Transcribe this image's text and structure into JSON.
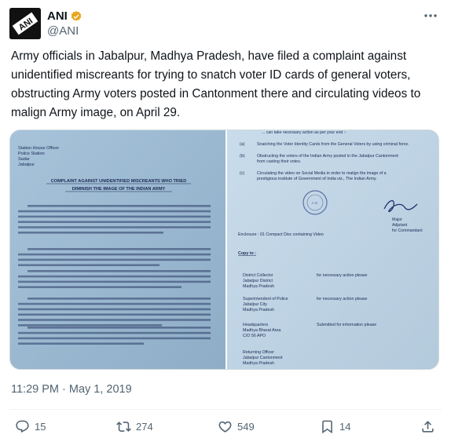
{
  "author": {
    "display_name": "ANI",
    "handle": "@ANI",
    "avatar_text": "ANI"
  },
  "tweet": {
    "text": "Army officials in Jabalpur, Madhya Pradesh, have filed a complaint against unidentified miscreants for trying to snatch voter ID cards of general voters, obstructing Army voters posted in Cantonment there and circulating videos to malign Army image, on April 29.",
    "timestamp": "11:29 PM · May 1, 2019"
  },
  "document_left": {
    "address": [
      "Station House Officer",
      "Police Station",
      "Sadar",
      "Jabalpur"
    ],
    "title_line1": "COMPLAINT AGAINST UNIDENTIFIED MISCREANTS WHO TRIED",
    "title_line2": "DIMINISH THE IMAGE OF THE INDIAN ARMY"
  },
  "document_right": {
    "top_line": "... can take necessary action as per your end :-",
    "points": [
      {
        "num": "(a)",
        "text": "Snatching the Voter Identity Cards from the General Voters by using criminal force."
      },
      {
        "num": "(b)",
        "text": "Obstructing the voters of the Indian Army posted in the Jabalpur Cantonment from casting their votes."
      },
      {
        "num": "(c)",
        "text": "Circulating the video on Social Media in order to malign the image of a prestigious institute of Government of India viz., The Indian Army."
      }
    ],
    "signature_lines": [
      "Major",
      "Adjutant",
      "for Commandant"
    ],
    "enclosure": "Enclosure : 01 Compact Disc containing Video",
    "copy_to": "Copy to :",
    "recipients": [
      {
        "name": [
          "District Collector",
          "Jabalpur District",
          "Madhya Pradesh"
        ],
        "note": "for necessary action please"
      },
      {
        "name": [
          "Superintendent of Police",
          "Jabalpur City",
          "Madhya Pradesh"
        ],
        "note": "for necessary action please"
      },
      {
        "name": [
          "Headquarters",
          "Madhya Bharat Area",
          "C/O 56 APO"
        ],
        "note": "Submitted for information please"
      },
      {
        "name": [
          "Returning Officer",
          "Jabalpur Cantonment",
          "Madhya Pradesh"
        ],
        "note": ""
      }
    ]
  },
  "stats": {
    "replies": "15",
    "retweets": "274",
    "likes": "549",
    "bookmarks": "14"
  },
  "colors": {
    "accent": "#1d9bf0",
    "secondary_text": "#536471",
    "verified_badge": "#e8a51c"
  }
}
